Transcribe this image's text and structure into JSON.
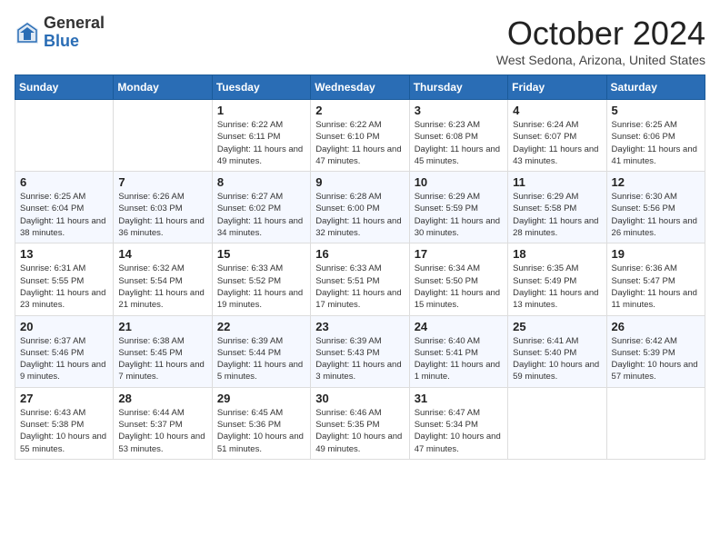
{
  "header": {
    "logo_general": "General",
    "logo_blue": "Blue",
    "month_title": "October 2024",
    "subtitle": "West Sedona, Arizona, United States"
  },
  "days_of_week": [
    "Sunday",
    "Monday",
    "Tuesday",
    "Wednesday",
    "Thursday",
    "Friday",
    "Saturday"
  ],
  "weeks": [
    [
      {
        "day": "",
        "detail": ""
      },
      {
        "day": "",
        "detail": ""
      },
      {
        "day": "1",
        "detail": "Sunrise: 6:22 AM\nSunset: 6:11 PM\nDaylight: 11 hours and 49 minutes."
      },
      {
        "day": "2",
        "detail": "Sunrise: 6:22 AM\nSunset: 6:10 PM\nDaylight: 11 hours and 47 minutes."
      },
      {
        "day": "3",
        "detail": "Sunrise: 6:23 AM\nSunset: 6:08 PM\nDaylight: 11 hours and 45 minutes."
      },
      {
        "day": "4",
        "detail": "Sunrise: 6:24 AM\nSunset: 6:07 PM\nDaylight: 11 hours and 43 minutes."
      },
      {
        "day": "5",
        "detail": "Sunrise: 6:25 AM\nSunset: 6:06 PM\nDaylight: 11 hours and 41 minutes."
      }
    ],
    [
      {
        "day": "6",
        "detail": "Sunrise: 6:25 AM\nSunset: 6:04 PM\nDaylight: 11 hours and 38 minutes."
      },
      {
        "day": "7",
        "detail": "Sunrise: 6:26 AM\nSunset: 6:03 PM\nDaylight: 11 hours and 36 minutes."
      },
      {
        "day": "8",
        "detail": "Sunrise: 6:27 AM\nSunset: 6:02 PM\nDaylight: 11 hours and 34 minutes."
      },
      {
        "day": "9",
        "detail": "Sunrise: 6:28 AM\nSunset: 6:00 PM\nDaylight: 11 hours and 32 minutes."
      },
      {
        "day": "10",
        "detail": "Sunrise: 6:29 AM\nSunset: 5:59 PM\nDaylight: 11 hours and 30 minutes."
      },
      {
        "day": "11",
        "detail": "Sunrise: 6:29 AM\nSunset: 5:58 PM\nDaylight: 11 hours and 28 minutes."
      },
      {
        "day": "12",
        "detail": "Sunrise: 6:30 AM\nSunset: 5:56 PM\nDaylight: 11 hours and 26 minutes."
      }
    ],
    [
      {
        "day": "13",
        "detail": "Sunrise: 6:31 AM\nSunset: 5:55 PM\nDaylight: 11 hours and 23 minutes."
      },
      {
        "day": "14",
        "detail": "Sunrise: 6:32 AM\nSunset: 5:54 PM\nDaylight: 11 hours and 21 minutes."
      },
      {
        "day": "15",
        "detail": "Sunrise: 6:33 AM\nSunset: 5:52 PM\nDaylight: 11 hours and 19 minutes."
      },
      {
        "day": "16",
        "detail": "Sunrise: 6:33 AM\nSunset: 5:51 PM\nDaylight: 11 hours and 17 minutes."
      },
      {
        "day": "17",
        "detail": "Sunrise: 6:34 AM\nSunset: 5:50 PM\nDaylight: 11 hours and 15 minutes."
      },
      {
        "day": "18",
        "detail": "Sunrise: 6:35 AM\nSunset: 5:49 PM\nDaylight: 11 hours and 13 minutes."
      },
      {
        "day": "19",
        "detail": "Sunrise: 6:36 AM\nSunset: 5:47 PM\nDaylight: 11 hours and 11 minutes."
      }
    ],
    [
      {
        "day": "20",
        "detail": "Sunrise: 6:37 AM\nSunset: 5:46 PM\nDaylight: 11 hours and 9 minutes."
      },
      {
        "day": "21",
        "detail": "Sunrise: 6:38 AM\nSunset: 5:45 PM\nDaylight: 11 hours and 7 minutes."
      },
      {
        "day": "22",
        "detail": "Sunrise: 6:39 AM\nSunset: 5:44 PM\nDaylight: 11 hours and 5 minutes."
      },
      {
        "day": "23",
        "detail": "Sunrise: 6:39 AM\nSunset: 5:43 PM\nDaylight: 11 hours and 3 minutes."
      },
      {
        "day": "24",
        "detail": "Sunrise: 6:40 AM\nSunset: 5:41 PM\nDaylight: 11 hours and 1 minute."
      },
      {
        "day": "25",
        "detail": "Sunrise: 6:41 AM\nSunset: 5:40 PM\nDaylight: 10 hours and 59 minutes."
      },
      {
        "day": "26",
        "detail": "Sunrise: 6:42 AM\nSunset: 5:39 PM\nDaylight: 10 hours and 57 minutes."
      }
    ],
    [
      {
        "day": "27",
        "detail": "Sunrise: 6:43 AM\nSunset: 5:38 PM\nDaylight: 10 hours and 55 minutes."
      },
      {
        "day": "28",
        "detail": "Sunrise: 6:44 AM\nSunset: 5:37 PM\nDaylight: 10 hours and 53 minutes."
      },
      {
        "day": "29",
        "detail": "Sunrise: 6:45 AM\nSunset: 5:36 PM\nDaylight: 10 hours and 51 minutes."
      },
      {
        "day": "30",
        "detail": "Sunrise: 6:46 AM\nSunset: 5:35 PM\nDaylight: 10 hours and 49 minutes."
      },
      {
        "day": "31",
        "detail": "Sunrise: 6:47 AM\nSunset: 5:34 PM\nDaylight: 10 hours and 47 minutes."
      },
      {
        "day": "",
        "detail": ""
      },
      {
        "day": "",
        "detail": ""
      }
    ]
  ]
}
